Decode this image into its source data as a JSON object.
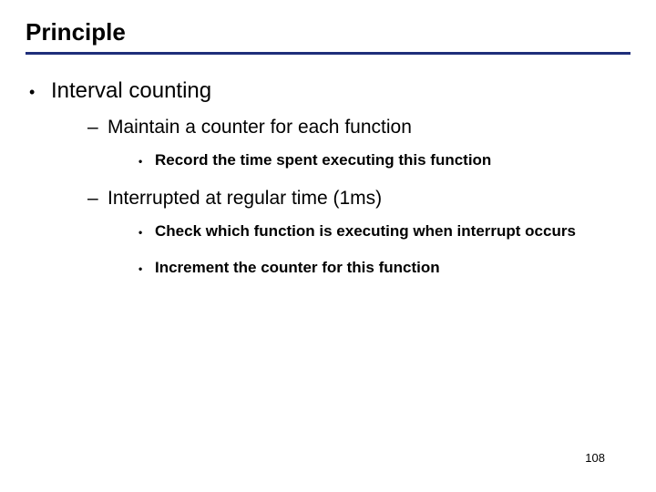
{
  "title": "Principle",
  "bullets": {
    "l1": "Interval counting",
    "l2a": "Maintain a counter for each function",
    "l3a": "Record the time spent executing this function",
    "l2b": "Interrupted at regular time (1ms)",
    "l3b": "Check which function is executing when interrupt occurs",
    "l3c": "Increment the counter for this function"
  },
  "page_number": "108"
}
